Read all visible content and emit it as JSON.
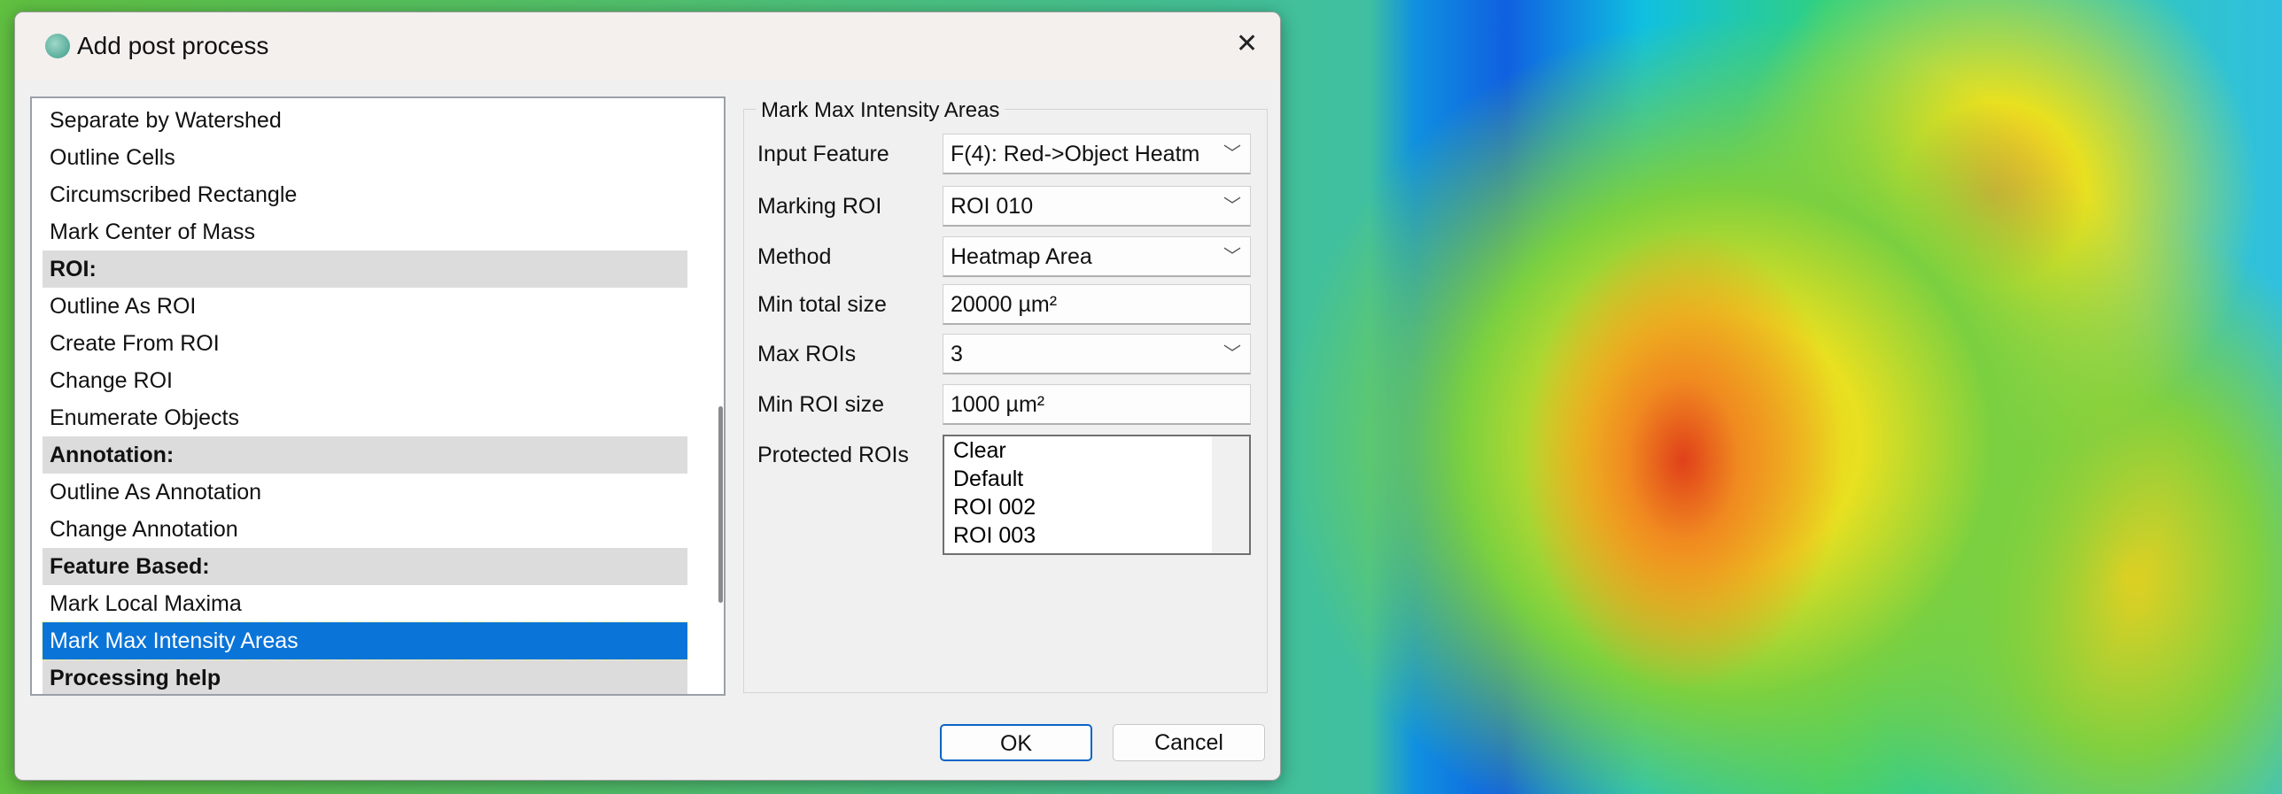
{
  "dialog": {
    "title": "Add post process",
    "close_icon": "close-icon"
  },
  "list": {
    "items": [
      {
        "label": "Separate by Watershed",
        "type": "item"
      },
      {
        "label": "Outline Cells",
        "type": "item"
      },
      {
        "label": "Circumscribed Rectangle",
        "type": "item"
      },
      {
        "label": "Mark Center of Mass",
        "type": "item"
      },
      {
        "label": "ROI:",
        "type": "header"
      },
      {
        "label": "Outline As ROI",
        "type": "item"
      },
      {
        "label": "Create From ROI",
        "type": "item"
      },
      {
        "label": "Change ROI",
        "type": "item"
      },
      {
        "label": "Enumerate Objects",
        "type": "item"
      },
      {
        "label": "Annotation:",
        "type": "header"
      },
      {
        "label": "Outline As Annotation",
        "type": "item"
      },
      {
        "label": "Change Annotation",
        "type": "item"
      },
      {
        "label": "Feature Based:",
        "type": "header"
      },
      {
        "label": "Mark Local Maxima",
        "type": "item"
      },
      {
        "label": "Mark Max Intensity Areas",
        "type": "selected"
      },
      {
        "label": "Processing help",
        "type": "header"
      }
    ]
  },
  "group": {
    "title": "Mark Max Intensity Areas",
    "input_feature": {
      "label": "Input Feature",
      "value": "F(4): Red->Object Heatm"
    },
    "marking_roi": {
      "label": "Marking ROI",
      "value": "ROI 010"
    },
    "method": {
      "label": "Method",
      "value": "Heatmap Area"
    },
    "min_total_size": {
      "label": "Min total size",
      "value": "20000 µm²"
    },
    "max_rois": {
      "label": "Max ROIs",
      "value": "3"
    },
    "min_roi_size": {
      "label": "Min ROI size",
      "value": "1000 µm²"
    },
    "protected_rois": {
      "label": "Protected ROIs",
      "options": [
        "Clear",
        "Default",
        "ROI 002",
        "ROI 003"
      ]
    }
  },
  "buttons": {
    "ok": "OK",
    "cancel": "Cancel"
  },
  "colors": {
    "selection": "#0a74d8",
    "default_border": "#0a64c8"
  }
}
